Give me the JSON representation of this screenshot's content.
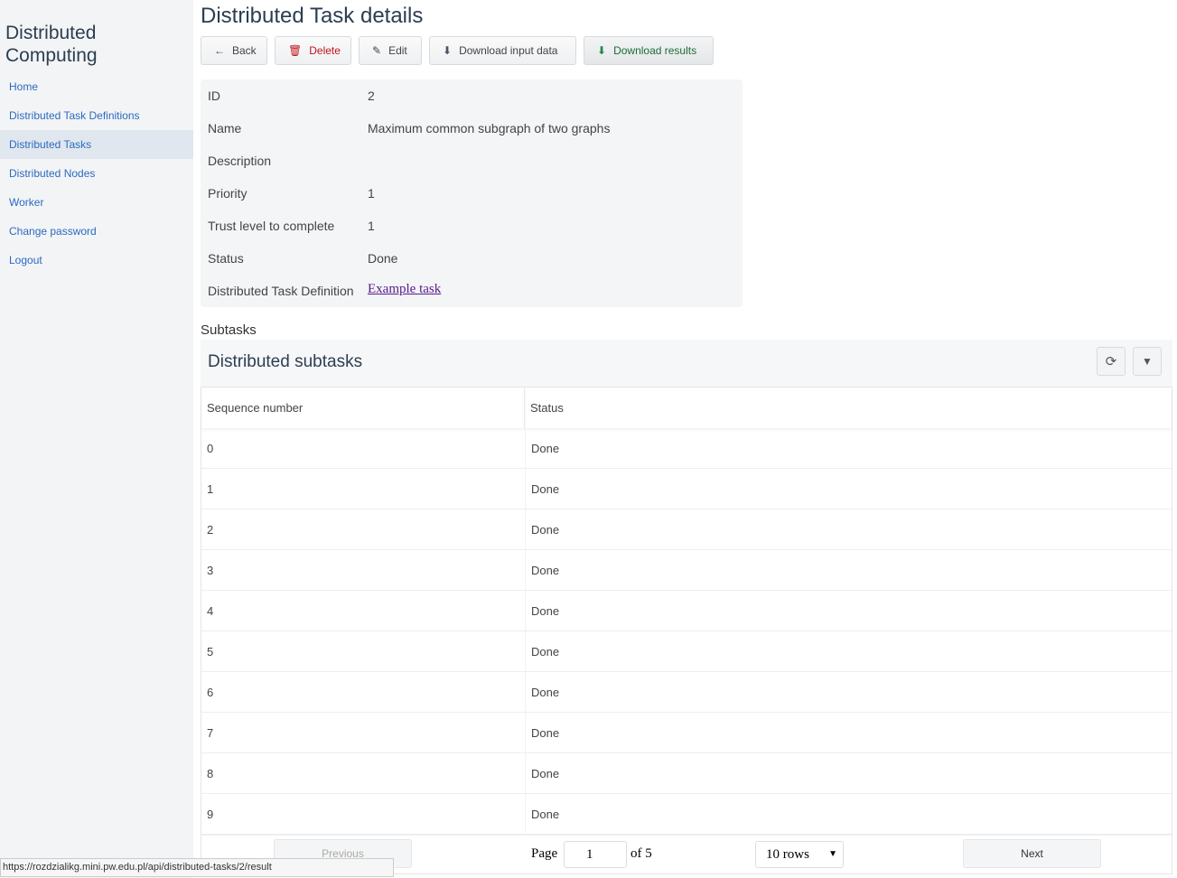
{
  "sidebar": {
    "brand": "Distributed Computing",
    "items": [
      {
        "label": "Home"
      },
      {
        "label": "Distributed Task Definitions"
      },
      {
        "label": "Distributed Tasks",
        "active": true
      },
      {
        "label": "Distributed Nodes"
      },
      {
        "label": "Worker"
      },
      {
        "label": "Change password"
      },
      {
        "label": "Logout"
      }
    ]
  },
  "page_title": "Distributed Task details",
  "toolbar": {
    "back": "Back",
    "delete": "Delete",
    "edit": "Edit",
    "download_input": "Download input data",
    "download_results": "Download results"
  },
  "details": [
    {
      "label": "ID",
      "value": "2"
    },
    {
      "label": "Name",
      "value": "Maximum common subgraph of two graphs"
    },
    {
      "label": "Description",
      "value": ""
    },
    {
      "label": "Priority",
      "value": "1"
    },
    {
      "label": "Trust level to complete",
      "value": "1"
    },
    {
      "label": "Status",
      "value": "Done"
    },
    {
      "label": "Distributed Task Definition",
      "value": "Example task"
    }
  ],
  "subtasks_label": "Subtasks",
  "panel_title": "Distributed subtasks",
  "table": {
    "columns": [
      "Sequence number",
      "Status"
    ],
    "rows": [
      [
        "0",
        "Done"
      ],
      [
        "1",
        "Done"
      ],
      [
        "2",
        "Done"
      ],
      [
        "3",
        "Done"
      ],
      [
        "4",
        "Done"
      ],
      [
        "5",
        "Done"
      ],
      [
        "6",
        "Done"
      ],
      [
        "7",
        "Done"
      ],
      [
        "8",
        "Done"
      ],
      [
        "9",
        "Done"
      ]
    ]
  },
  "pagination": {
    "previous": "Previous",
    "page_label": "Page",
    "page": "1",
    "of": "of 5",
    "rows": "10 rows",
    "next": "Next"
  },
  "status_url": "https://rozdzialikg.mini.pw.edu.pl/api/distributed-tasks/2/result"
}
